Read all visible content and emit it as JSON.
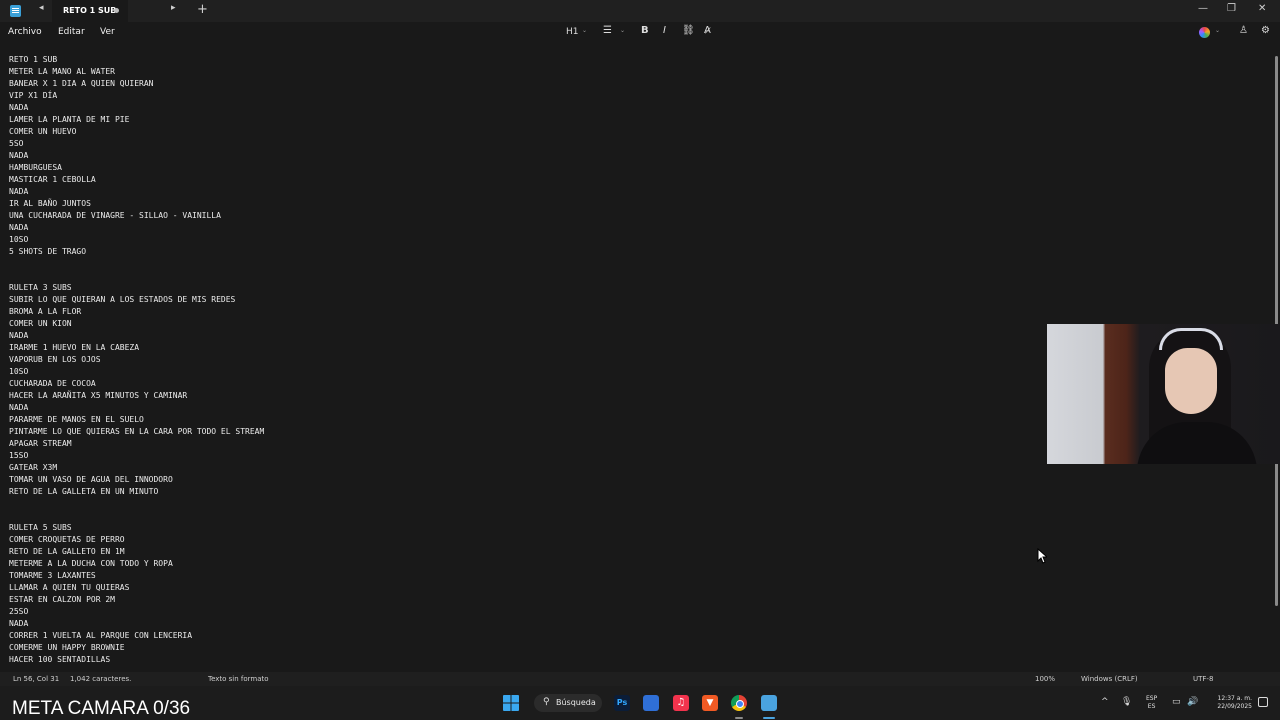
{
  "window": {
    "tab_title": "RETO 1 SUB",
    "back_glyph": "◂",
    "forward_glyph": "▸",
    "new_tab_glyph": "+",
    "minimize_glyph": "—",
    "maximize_glyph": "❐",
    "close_glyph": "✕"
  },
  "menu": {
    "items": [
      "Archivo",
      "Editar",
      "Ver"
    ]
  },
  "toolbar": {
    "heading_label": "H1",
    "list_glyph": "☰",
    "bold_label": "B",
    "italic_label": "I",
    "link_glyph": "⛓",
    "clear_format_glyph": "A̷",
    "dropdown_glyph": "⌄",
    "account_glyph": "♙",
    "settings_glyph": "⚙"
  },
  "document": {
    "lines": [
      "RETO 1 SUB",
      "METER LA MANO AL WATER",
      "BANEAR X 1 DIA A QUIEN QUIERAN",
      "VIP X1 DÍA",
      "NADA",
      "LAMER LA PLANTA DE MI PIE",
      "COMER UN HUEVO",
      "5SO",
      "NADA",
      "HAMBURGUESA",
      "MASTICAR 1 CEBOLLA",
      "NADA",
      "IR AL BAÑO JUNTOS",
      "UNA CUCHARADA DE VINAGRE - SILLAO - VAINILLA",
      "NADA",
      "10SO",
      "5 SHOTS DE TRAGO",
      "",
      "",
      "RULETA 3 SUBS",
      "SUBIR LO QUE QUIERAN A LOS ESTADOS DE MIS REDES",
      "BROMA A LA FLOR",
      "COMER UN KION",
      "NADA",
      "IRARME 1 HUEVO EN LA CABEZA",
      "VAPORUB EN LOS OJOS",
      "10SO",
      "CUCHARADA DE COCOA",
      "HACER LA ARAÑITA X5 MINUTOS Y CAMINAR",
      "NADA",
      "PARARME DE MANOS EN EL SUELO",
      "PINTARME LO QUE QUIERAS EN LA CARA POR TODO EL STREAM",
      "APAGAR STREAM",
      "15SO",
      "GATEAR X3M",
      "TOMAR UN VASO DE AGUA DEL INNODORO",
      "RETO DE LA GALLETA EN UN MINUTO",
      "",
      "",
      "RULETA 5 SUBS",
      "COMER CROQUETAS DE PERRO",
      "RETO DE LA GALLETO EN 1M",
      "METERME A LA DUCHA CON TODO Y ROPA",
      "TOMARME 3 LAXANTES",
      "LLAMAR A QUIEN TU QUIERAS",
      "ESTAR EN CALZON POR 2M",
      "25SO",
      "NADA",
      "CORRER 1 VUELTA AL PARQUE CON LENCERIA",
      "COMERME UN HAPPY BROWNIE",
      "HACER 100 SENTADILLAS"
    ]
  },
  "status": {
    "position": "Ln 56, Col 31",
    "char_count": "1,042 caracteres.",
    "format": "Texto sin formato",
    "zoom": "100%",
    "line_ending": "Windows (CRLF)",
    "encoding": "UTF-8"
  },
  "overlay": {
    "meta_text": "META CAMARA 0/36"
  },
  "taskbar": {
    "search_label": "Búsqueda",
    "search_glyph": "⚲",
    "ps_label": "Ps",
    "music_glyph": "♫",
    "brave_glyph": "▼",
    "tray_chevron": "^",
    "mic_glyph": "🎙",
    "lang_top": "ESP",
    "lang_bottom": "ES",
    "network_glyph": "▭",
    "volume_glyph": "🔊",
    "time": "12:37 a. m.",
    "date": "22/09/2025"
  },
  "colors": {
    "background": "#191919",
    "text": "#ececec",
    "windows_accent": "#3aa8f0"
  }
}
